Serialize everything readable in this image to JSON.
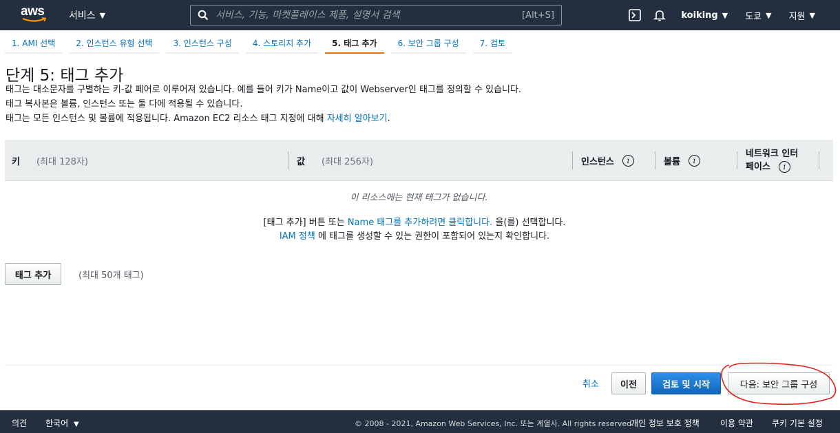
{
  "nav": {
    "logo": "aws",
    "services": "서비스",
    "search_placeholder": "서비스, 기능, 마켓플레이스 제품, 설명서 검색",
    "search_shortcut": "[Alt+S]",
    "user": "koiking",
    "region": "도쿄",
    "support": "지원"
  },
  "steps": [
    "1. AMI 선택",
    "2. 인스턴스 유형 선택",
    "3. 인스턴스 구성",
    "4. 스토리지 추가",
    "5. 태그 추가",
    "6. 보안 그룹 구성",
    "7. 검토"
  ],
  "page": {
    "title": "단계 5: 태그 추가",
    "desc1": "태그는 대소문자를 구별하는 키-값 페어로 이루어져 있습니다. 예를 들어 키가 Name이고 값이 Webserver인 태그를 정의할 수 있습니다.",
    "desc2": "태그 복사본은 볼륨, 인스턴스 또는 둘 다에 적용될 수 있습니다.",
    "desc3_pre": "태그는 모든 인스턴스 및 볼륨에 적용됩니다. Amazon EC2 리소스 태그 지정에 대해 ",
    "desc3_link": "자세히 알아보기",
    "desc3_post": "."
  },
  "table": {
    "key_label": "키",
    "key_hint": "(최대 128자)",
    "value_label": "값",
    "value_hint": "(최대 256자)",
    "instances_label": "인스턴스",
    "volumes_label": "볼륨",
    "network_label_1": "네트워크 인터",
    "network_label_2": "페이스",
    "info_glyph": "i",
    "empty_message": "이 리소스에는 현재 태그가 없습니다."
  },
  "help": {
    "line1_pre": "[태그 추가] 버튼 또는 ",
    "line1_link": "Name 태그를 추가하려면 클릭합니다.",
    "line1_post": " 을(를) 선택합니다.",
    "line2_link": "IAM 정책",
    "line2_post": " 에 태그를 생성할 수 있는 권한이 포함되어 있는지 확인합니다."
  },
  "actions": {
    "add_tag": "태그 추가",
    "max_tags": "(최대 50개 태그)",
    "cancel": "취소",
    "previous": "이전",
    "review_launch": "검토 및 시작",
    "next": "다음: 보안 그룹 구성"
  },
  "footer": {
    "feedback": "의견",
    "language": "한국어",
    "copyright": "© 2008 - 2021, Amazon Web Services, Inc. 또는 계열사. All rights reserved.",
    "privacy": "개인 정보 보호 정책",
    "terms": "이용 약관",
    "cookies": "쿠키 기본 설정"
  },
  "colors": {
    "nav_bg": "#232f3e",
    "link": "#0073bb",
    "active_step": "#ec7211",
    "primary_button": "#1166bb",
    "annotation": "#e0201b"
  }
}
